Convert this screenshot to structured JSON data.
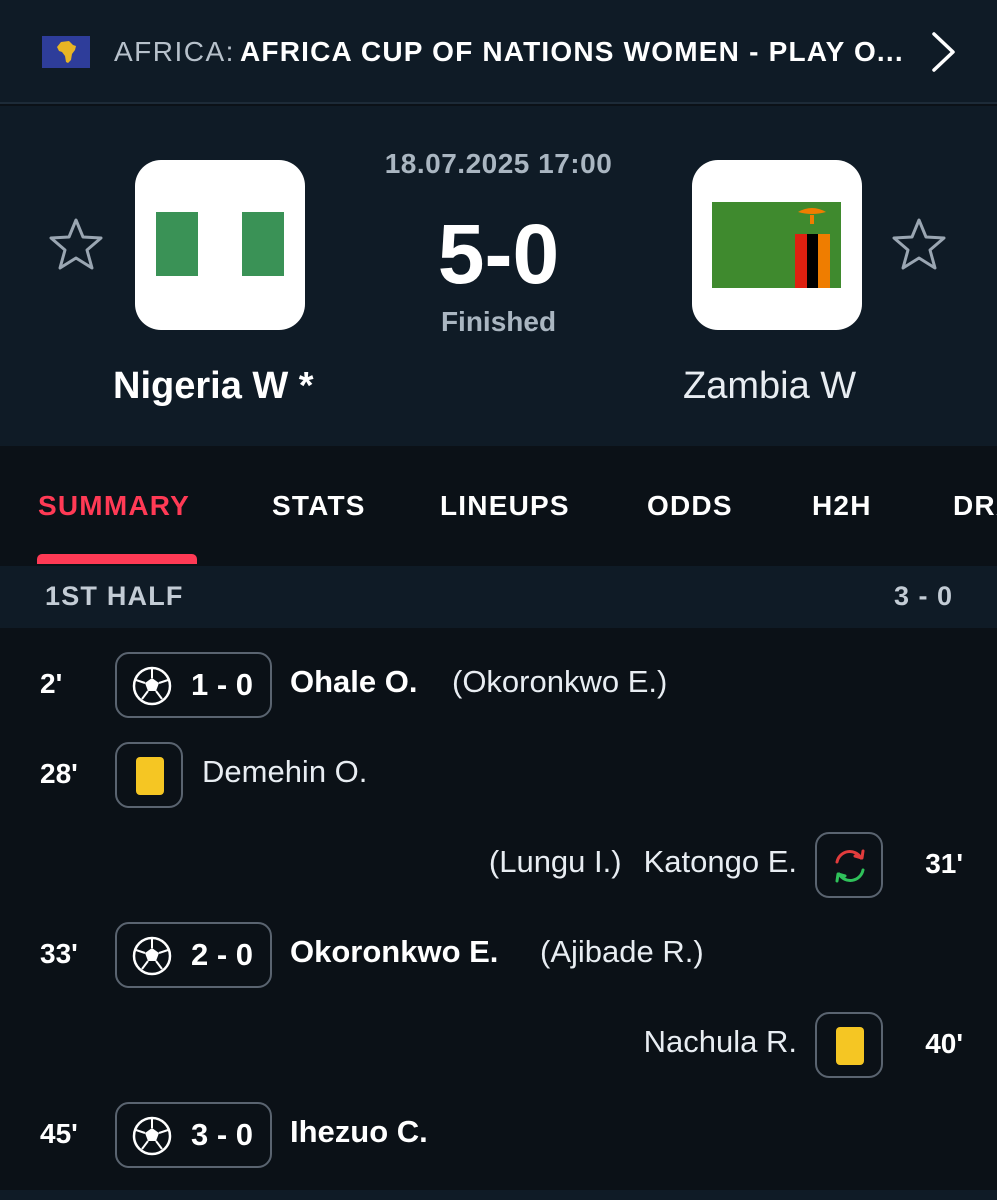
{
  "competition": {
    "region": "AFRICA:",
    "name": "AFRICA CUP OF NATIONS WOMEN - PLAY O...",
    "flag_icon": "africa-flag-icon",
    "flag_color": "#2e3d9a"
  },
  "match": {
    "datetime": "18.07.2025 17:00",
    "score": "5-0",
    "status": "Finished",
    "home": {
      "name": "Nigeria W *",
      "logo_icon": "nigeria-flag-icon"
    },
    "away": {
      "name": "Zambia W",
      "logo_icon": "zambia-flag-icon"
    }
  },
  "tabs": [
    {
      "label": "SUMMARY",
      "active": true
    },
    {
      "label": "STATS"
    },
    {
      "label": "LINEUPS"
    },
    {
      "label": "ODDS"
    },
    {
      "label": "H2H"
    },
    {
      "label": "DRAW"
    }
  ],
  "section": {
    "title": "1ST HALF",
    "score": "3 - 0"
  },
  "events": [
    {
      "minute": "2'",
      "side": "home",
      "type": "goal",
      "score": "1 - 0",
      "player": "Ohale O.",
      "assist": "(Okoronkwo E.)"
    },
    {
      "minute": "28'",
      "side": "home",
      "type": "yellow-card",
      "player": "Demehin O."
    },
    {
      "minute": "31'",
      "side": "away",
      "type": "substitution",
      "player_in": "Katongo E.",
      "player_out": "(Lungu I.)"
    },
    {
      "minute": "33'",
      "side": "home",
      "type": "goal",
      "score": "2 - 0",
      "player": "Okoronkwo E.",
      "assist": "(Ajibade R.)"
    },
    {
      "minute": "40'",
      "side": "away",
      "type": "yellow-card",
      "player": "Nachula R."
    },
    {
      "minute": "45'",
      "side": "home",
      "type": "goal",
      "score": "3 - 0",
      "player": "Ihezuo C."
    }
  ],
  "colors": {
    "accent": "#ff3a55",
    "yellow_card": "#f5c623",
    "background": "#0b1117",
    "panel": "#0f1b26"
  }
}
